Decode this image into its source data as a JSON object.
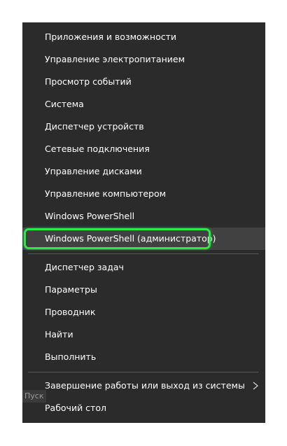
{
  "menu": {
    "items": [
      {
        "label": "Приложения и возможности"
      },
      {
        "label": "Управление электропитанием"
      },
      {
        "label": "Просмотр событий"
      },
      {
        "label": "Система"
      },
      {
        "label": "Диспетчер устройств"
      },
      {
        "label": "Сетевые подключения"
      },
      {
        "label": "Управление дисками"
      },
      {
        "label": "Управление компьютером"
      },
      {
        "label": "Windows PowerShell"
      },
      {
        "label": "Windows PowerShell (администратор)"
      },
      {
        "label": "Диспетчер задач"
      },
      {
        "label": "Параметры"
      },
      {
        "label": "Проводник"
      },
      {
        "label": "Найти"
      },
      {
        "label": "Выполнить"
      },
      {
        "label": "Завершение работы или выход из системы",
        "icon": "chevron-right-icon"
      },
      {
        "label": "Рабочий стол"
      }
    ],
    "highlight_color": "#2ee84a",
    "background_color": "#2b2b2b"
  },
  "tooltip": {
    "text": "Пуск"
  }
}
